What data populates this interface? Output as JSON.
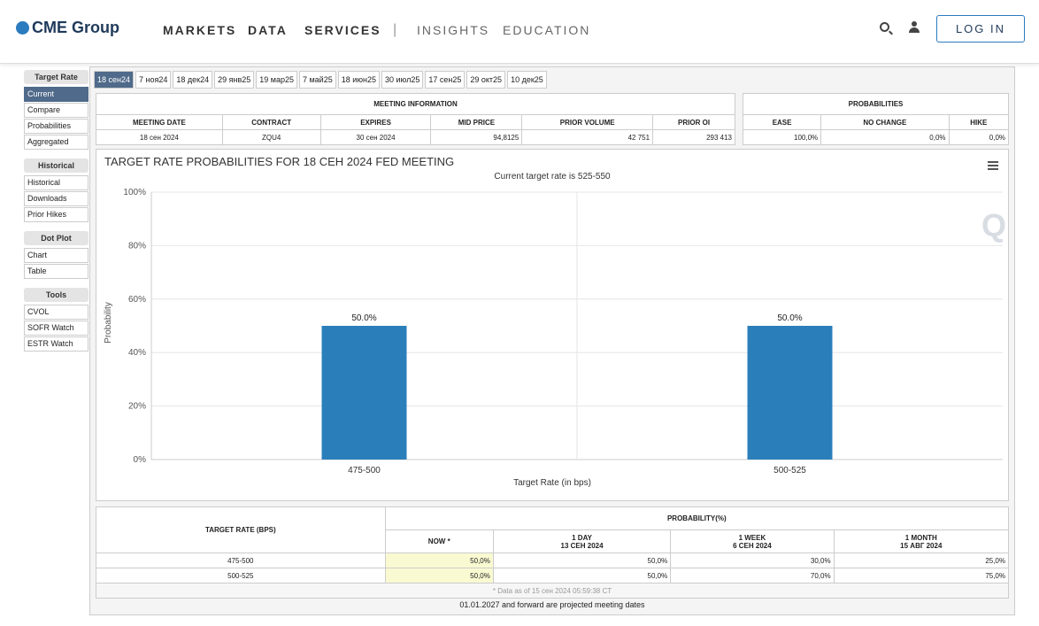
{
  "header": {
    "logo": "CME Group",
    "nav": [
      "MARKETS",
      "DATA",
      "SERVICES"
    ],
    "nav_light": [
      "INSIGHTS",
      "EDUCATION"
    ],
    "separator": "|",
    "login": "LOG IN"
  },
  "sidebar": {
    "sections": [
      {
        "title": "Target Rate",
        "items": [
          "Current",
          "Compare",
          "Probabilities",
          "Aggregated"
        ]
      },
      {
        "title": "Historical",
        "items": [
          "Historical",
          "Downloads",
          "Prior Hikes"
        ]
      },
      {
        "title": "Dot Plot",
        "items": [
          "Chart",
          "Table"
        ]
      },
      {
        "title": "Tools",
        "items": [
          "CVOL",
          "SOFR Watch",
          "ESTR Watch"
        ]
      }
    ]
  },
  "tabs": [
    "18 сен24",
    "7 ноя24",
    "18 дек24",
    "29 янв25",
    "19 мар25",
    "7 май25",
    "18 июн25",
    "30 июл25",
    "17 сен25",
    "29 окт25",
    "10 дек25"
  ],
  "meeting": {
    "title": "MEETING INFORMATION",
    "headers": [
      "MEETING DATE",
      "CONTRACT",
      "EXPIRES",
      "MID PRICE",
      "PRIOR VOLUME",
      "PRIOR OI"
    ],
    "values": [
      "18 сен 2024",
      "ZQU4",
      "30 сен 2024",
      "94,8125",
      "42 751",
      "293 413"
    ]
  },
  "probabilities": {
    "title": "PROBABILITIES",
    "headers": [
      "EASE",
      "NO CHANGE",
      "HIKE"
    ],
    "values": [
      "100,0%",
      "0,0%",
      "0,0%"
    ]
  },
  "chart_data": {
    "type": "bar",
    "title": "TARGET RATE PROBABILITIES FOR 18 СЕН 2024 FED MEETING",
    "subtitle": "Current target rate is 525-550",
    "xlabel": "Target Rate (in bps)",
    "ylabel": "Probability",
    "categories": [
      "475-500",
      "500-525"
    ],
    "values": [
      50.0,
      50.0
    ],
    "data_labels": [
      "50.0%",
      "50.0%"
    ],
    "ylim": [
      0,
      100
    ],
    "yticks": [
      "0%",
      "20%",
      "40%",
      "60%",
      "80%",
      "100%"
    ],
    "grid": true,
    "bar_color": "#2a7fba"
  },
  "prob_table": {
    "col_rate": "TARGET RATE (BPS)",
    "col_prob": "PROBABILITY(%)",
    "subheaders": [
      {
        "l1": "NOW *",
        "l2": ""
      },
      {
        "l1": "1 DAY",
        "l2": "13 СЕН 2024"
      },
      {
        "l1": "1 WEEK",
        "l2": "6 СЕН 2024"
      },
      {
        "l1": "1 MONTH",
        "l2": "15 АВГ 2024"
      }
    ],
    "rows": [
      {
        "rate": "475-500",
        "vals": [
          "50,0%",
          "50,0%",
          "30,0%",
          "25,0%"
        ]
      },
      {
        "rate": "500-525",
        "vals": [
          "50,0%",
          "50,0%",
          "70,0%",
          "75,0%"
        ]
      }
    ],
    "note": "* Data as of 15 сен 2024 05:59:38 CT"
  },
  "footer": "01.01.2027 and forward are projected meeting dates"
}
